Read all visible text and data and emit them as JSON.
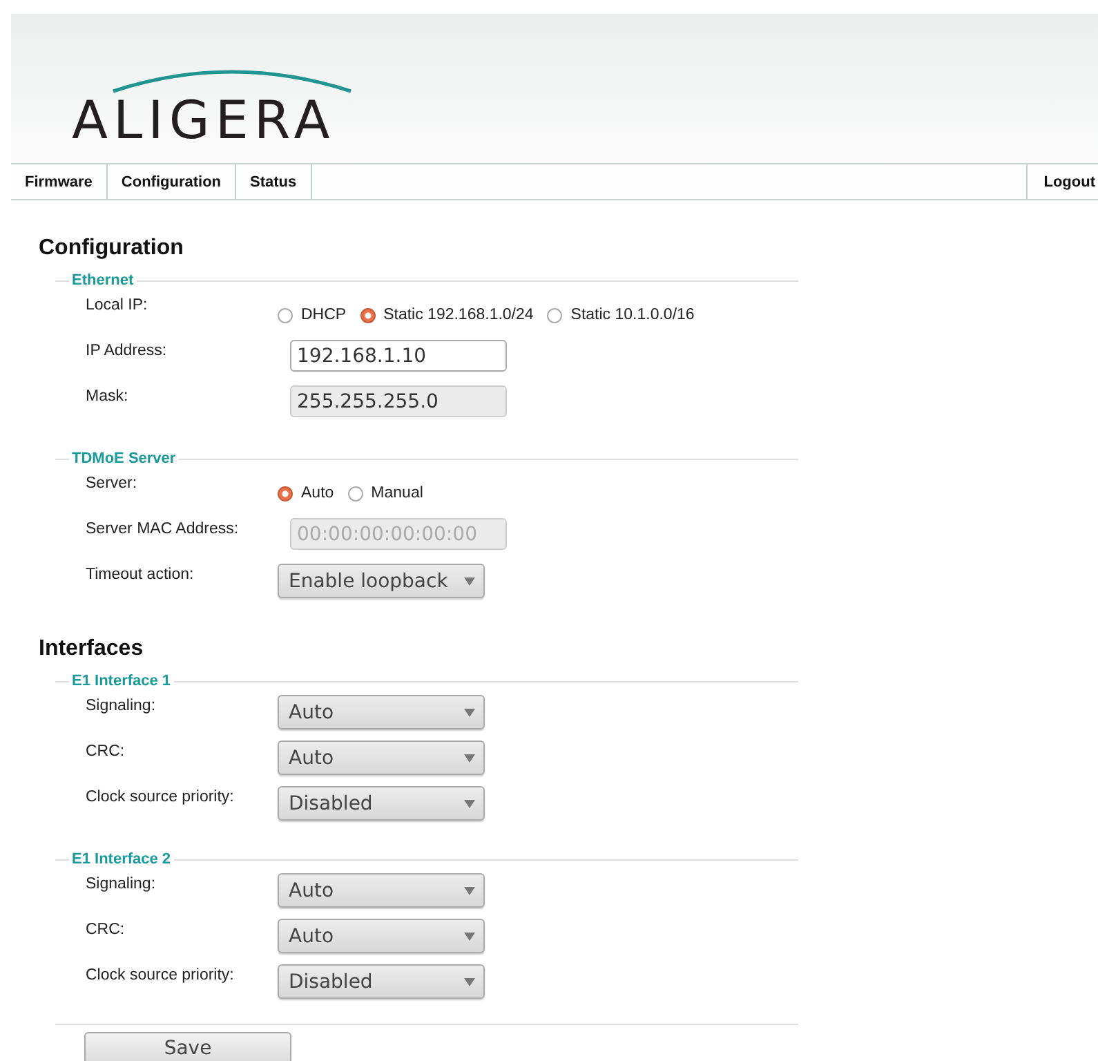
{
  "header": {
    "logo": "ALIGERA"
  },
  "nav": {
    "items": [
      "Firmware",
      "Configuration",
      "Status"
    ],
    "logout": "Logout"
  },
  "sections": [
    {
      "title": "Configuration",
      "groups": [
        {
          "legend": "Ethernet",
          "rows": [
            {
              "label": "Local IP:",
              "kind": "radio",
              "options": [
                {
                  "label": "DHCP",
                  "selected": false
                },
                {
                  "label": "Static 192.168.1.0/24",
                  "selected": true
                },
                {
                  "label": "Static 10.1.0.0/16",
                  "selected": false
                }
              ]
            },
            {
              "label": "IP Address:",
              "kind": "text",
              "value": "192.168.1.10",
              "disabled": false
            },
            {
              "label": "Mask:",
              "kind": "text",
              "value": "255.255.255.0",
              "disabled": true
            }
          ]
        },
        {
          "legend": "TDMoE Server",
          "rows": [
            {
              "label": "Server:",
              "kind": "radio",
              "options": [
                {
                  "label": "Auto",
                  "selected": true
                },
                {
                  "label": "Manual",
                  "selected": false
                }
              ]
            },
            {
              "label": "Server MAC Address:",
              "kind": "text",
              "placeholder": "00:00:00:00:00:00",
              "disabled": true
            },
            {
              "label": "Timeout action:",
              "kind": "select",
              "value": "Enable loopback"
            }
          ]
        }
      ]
    },
    {
      "title": "Interfaces",
      "groups": [
        {
          "legend": "E1 Interface 1",
          "rows": [
            {
              "label": "Signaling:",
              "kind": "select",
              "value": "Auto"
            },
            {
              "label": "CRC:",
              "kind": "select",
              "value": "Auto"
            },
            {
              "label": "Clock source priority:",
              "kind": "select",
              "value": "Disabled"
            }
          ]
        },
        {
          "legend": "E1 Interface 2",
          "rows": [
            {
              "label": "Signaling:",
              "kind": "select",
              "value": "Auto"
            },
            {
              "label": "CRC:",
              "kind": "select",
              "value": "Auto"
            },
            {
              "label": "Clock source priority:",
              "kind": "select",
              "value": "Disabled"
            }
          ]
        }
      ]
    }
  ],
  "save_button": "Save"
}
